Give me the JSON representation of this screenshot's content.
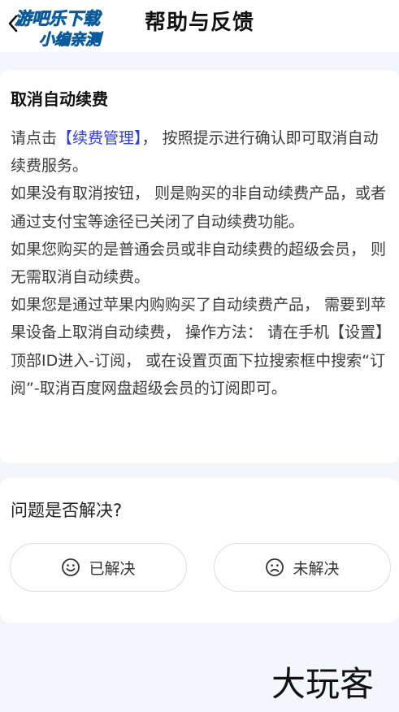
{
  "header": {
    "title": "帮助与反馈",
    "back_icon": "chevron-left-icon",
    "watermark": {
      "line1": "游吧乐下载",
      "line2": "小编亲测"
    }
  },
  "answer": {
    "title": "取消自动续费",
    "paragraphs": {
      "p1": {
        "before": "请点击",
        "link": "【续费管理】",
        "after": "， 按照提示进行确认即可取消自动续费服务。"
      },
      "p2": "如果没有取消按钮， 则是购买的非自动续费产品，或者通过支付宝等途径已关闭了自动续费功能。",
      "p3": "如果您购买的是普通会员或非自动续费的超级会员， 则无需取消自动续费。",
      "p4": "如果您是通过苹果内购购买了自动续费产品， 需要到苹果设备上取消自动续费， 操作方法： 请在手机【设置】顶部ID进入-订阅， 或在设置页面下拉搜索框中搜索“订阅”-取消百度网盘超级会员的订阅即可。"
    }
  },
  "feedback": {
    "question": "问题是否解决?",
    "solved_label": "已解决",
    "solved_icon": "smile-face-icon",
    "unsolved_label": "未解决",
    "unsolved_icon": "sad-face-icon"
  },
  "watermark_bottom": "大玩客",
  "colors": {
    "link": "#3440d6",
    "background": "#f4f6fb",
    "card": "#ffffff"
  }
}
